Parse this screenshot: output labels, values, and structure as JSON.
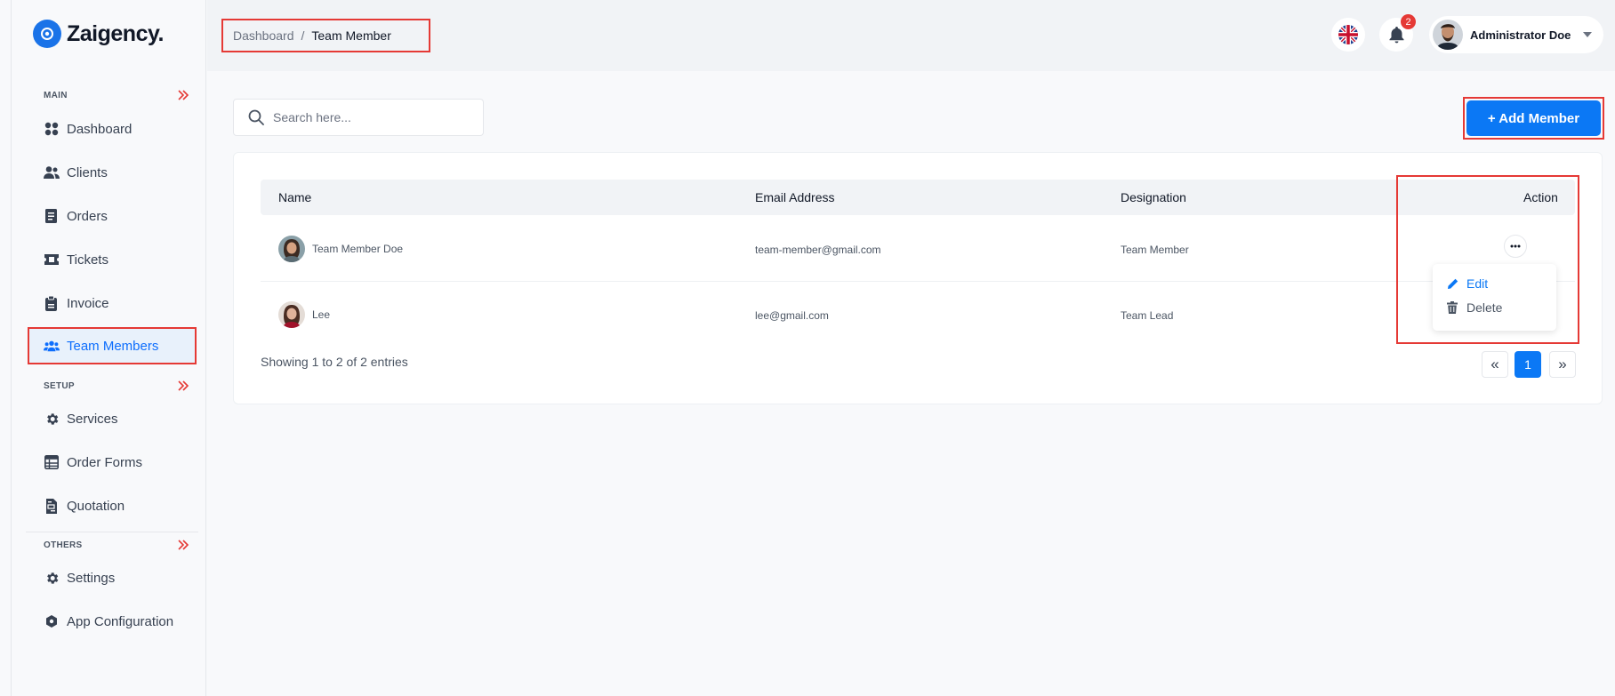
{
  "brand": {
    "name": "Zaigency.",
    "accent": "#0b78f5",
    "highlight": "#e53935"
  },
  "sidebar": {
    "sections": [
      {
        "title": "MAIN",
        "arrow_icon": "double-chevron-right-icon"
      },
      {
        "title": "SETUP",
        "arrow_icon": "double-chevron-right-icon"
      },
      {
        "title": "OTHERS",
        "arrow_icon": "double-chevron-right-icon"
      }
    ],
    "items": [
      {
        "label": "Dashboard",
        "icon": "dashboard-grid-icon"
      },
      {
        "label": "Clients",
        "icon": "users-icon"
      },
      {
        "label": "Orders",
        "icon": "document-icon"
      },
      {
        "label": "Tickets",
        "icon": "ticket-icon"
      },
      {
        "label": "Invoice",
        "icon": "clipboard-icon"
      },
      {
        "label": "Team Members",
        "icon": "team-icon",
        "active": true
      },
      {
        "label": "Services",
        "icon": "gear-icon"
      },
      {
        "label": "Order Forms",
        "icon": "table-list-icon"
      },
      {
        "label": "Quotation",
        "icon": "file-invoice-icon"
      },
      {
        "label": "Settings",
        "icon": "gear-icon"
      },
      {
        "label": "App Configuration",
        "icon": "hexagon-gear-icon"
      }
    ]
  },
  "header": {
    "breadcrumb": {
      "parent": "Dashboard",
      "separator": "/",
      "current": "Team Member"
    },
    "language_icon": "uk-flag-icon",
    "notifications": {
      "icon": "bell-icon",
      "count": "2"
    },
    "user": {
      "name": "Administrator Doe",
      "caret_icon": "caret-down-icon"
    }
  },
  "search": {
    "placeholder": "Search here...",
    "value": ""
  },
  "add_button": {
    "label": "+ Add Member"
  },
  "table": {
    "columns": [
      "Name",
      "Email Address",
      "Designation",
      "Action"
    ],
    "rows": [
      {
        "name": "Team Member Doe",
        "email": "team-member@gmail.com",
        "designation": "Team Member"
      },
      {
        "name": "Lee",
        "email": "lee@gmail.com",
        "designation": "Team Lead"
      }
    ]
  },
  "action_menu": {
    "edit": "Edit",
    "delete": "Delete"
  },
  "footer": {
    "showing": "Showing 1 to 2 of 2 entries",
    "pagination": {
      "prev": "«",
      "current": "1",
      "next": "»"
    }
  }
}
